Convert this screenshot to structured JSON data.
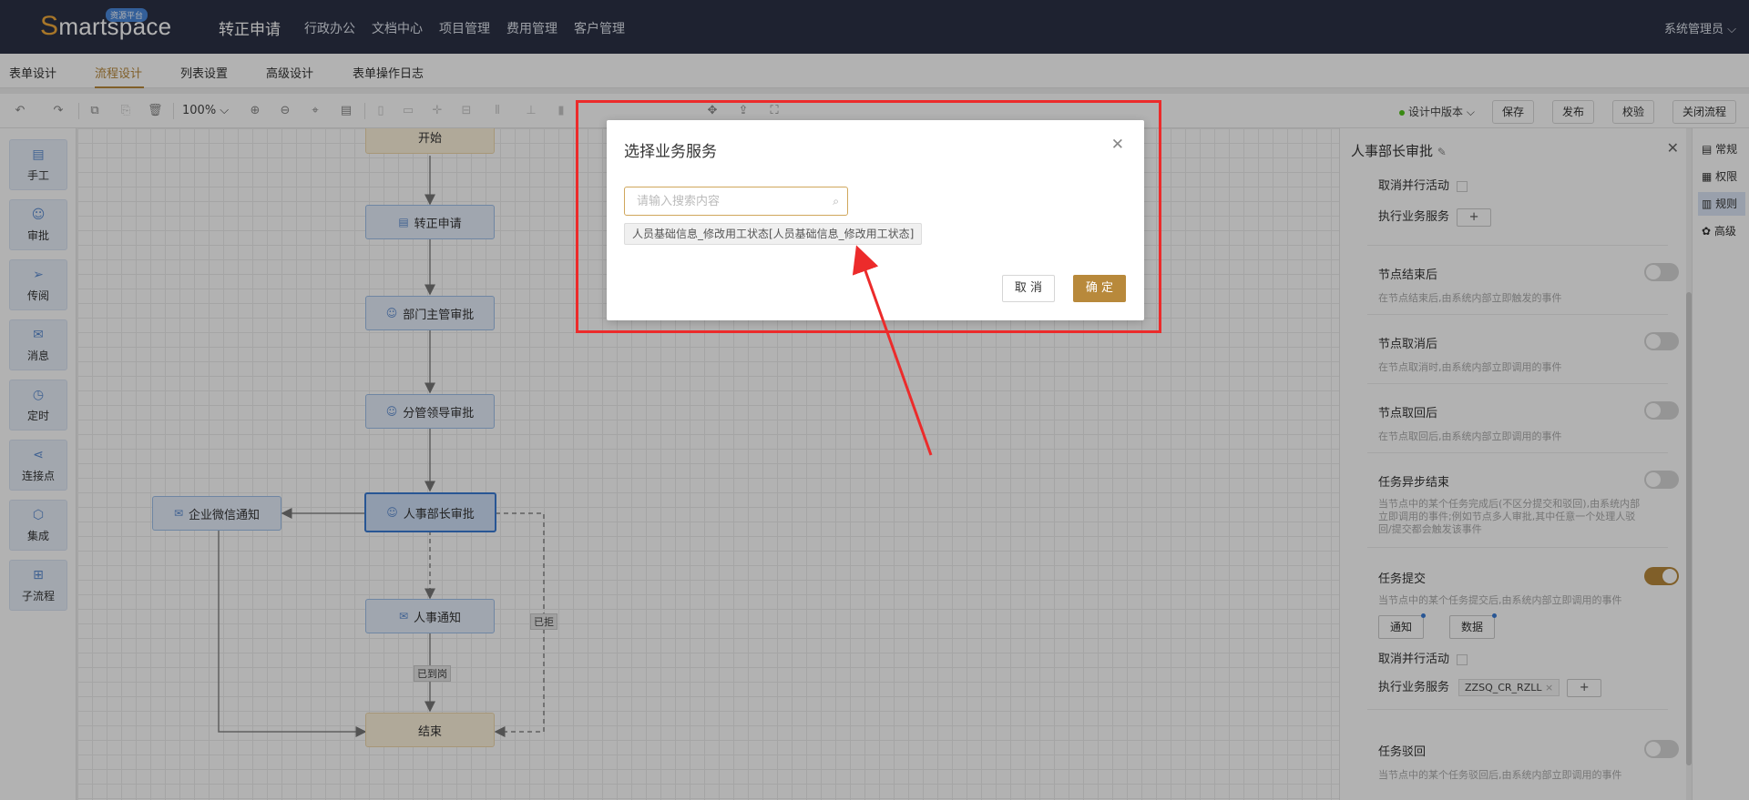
{
  "header": {
    "logo_text": "Smartspace",
    "logo_badge": "资源平台",
    "app_title": "转正申请",
    "nav": [
      "行政办公",
      "文档中心",
      "项目管理",
      "费用管理",
      "客户管理"
    ],
    "user": "系统管理员"
  },
  "tabs": [
    "表单设计",
    "流程设计",
    "列表设置",
    "高级设计",
    "表单操作日志"
  ],
  "toolbar": {
    "zoom": "100%",
    "version": "设计中版本",
    "buttons": [
      "保存",
      "发布",
      "校验",
      "关闭流程"
    ]
  },
  "palette": [
    "手工",
    "审批",
    "传阅",
    "消息",
    "定时",
    "连接点",
    "集成",
    "子流程"
  ],
  "flow": {
    "nodes": {
      "start": "开始",
      "apply": "转正申请",
      "dept": "部门主管审批",
      "leader": "分管领导审批",
      "hr": "人事部长审批",
      "wechat": "企业微信通知",
      "notice": "人事通知",
      "end": "结束"
    },
    "edge_labels": {
      "rejected": "已拒",
      "transferred": "已到岗"
    }
  },
  "panel": {
    "title": "人事部长审批",
    "cancel_parallel": "取消并行活动",
    "exec_service": "执行业务服务",
    "sections": [
      {
        "title": "节点结束后",
        "desc": "在节点结束后,由系统内部立即触发的事件",
        "on": false
      },
      {
        "title": "节点取消后",
        "desc": "在节点取消时,由系统内部立即调用的事件",
        "on": false
      },
      {
        "title": "节点取回后",
        "desc": "在节点取回后,由系统内部立即调用的事件",
        "on": false
      },
      {
        "title": "任务异步结束",
        "desc": "当节点中的某个任务完成后(不区分提交和驳回),由系统内部立即调用的事件;例如节点多人审批,其中任意一个处理人驳回/提交都会触发该事件",
        "on": false
      },
      {
        "title": "任务提交",
        "desc": "当节点中的某个任务提交后,由系统内部立即调用的事件",
        "on": true
      },
      {
        "title": "任务驳回",
        "desc": "当节点中的某个任务驳回后,由系统内部立即调用的事件",
        "on": false
      }
    ],
    "submit_buttons": [
      "通知",
      "数据"
    ],
    "service_tag": "ZZSQ_CR_RZLL"
  },
  "side_tabs": [
    "常规",
    "权限",
    "规则",
    "高级"
  ],
  "modal": {
    "title": "选择业务服务",
    "search_placeholder": "请输入搜索内容",
    "result": "人员基础信息_修改用工状态[人员基础信息_修改用工状态]",
    "cancel": "取 消",
    "ok": "确 定"
  },
  "colors": {
    "accent": "#b8893b",
    "topbar": "#2b3245",
    "highlight": "#ec2b2b"
  }
}
